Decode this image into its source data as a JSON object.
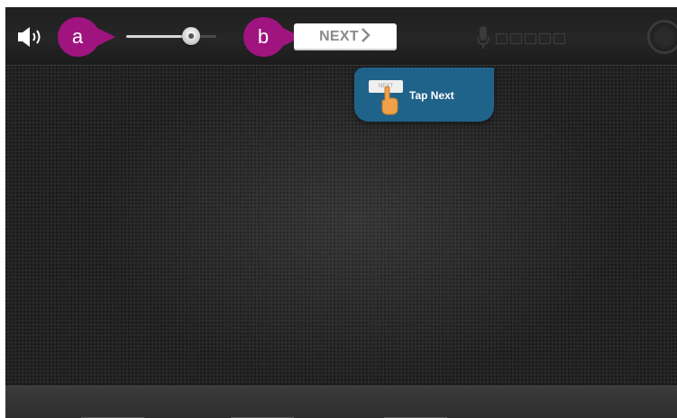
{
  "toolbar": {
    "callout_a": "a",
    "callout_b": "b",
    "next_label": "NEXT",
    "volume_level": 0.72,
    "mic_meter_segments": 5
  },
  "tooltip": {
    "mini_button_label": "NEXT",
    "text": "Tap Next"
  },
  "icons": {
    "speaker": "speaker-volume-icon",
    "chevron": "chevron-right-icon",
    "mic": "microphone-icon",
    "record": "record-icon",
    "hand": "tap-hand-icon"
  },
  "colors": {
    "callout": "#a0147f",
    "tooltip": "#20638a",
    "background": "#262626",
    "next_text": "#8a8a8a"
  }
}
